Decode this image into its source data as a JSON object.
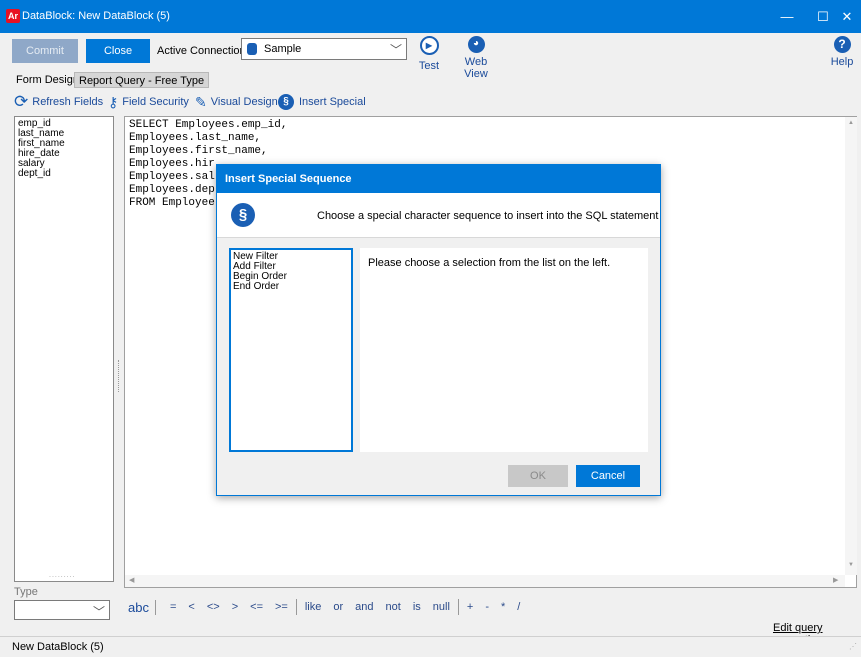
{
  "window": {
    "title": "DataBlock: New DataBlock (5)",
    "app_badge": "Ar",
    "minimize": "—",
    "maximize": "☐",
    "close": "✕"
  },
  "toolbar": {
    "commit": "Commit",
    "close": "Close",
    "active_connection_label": "Active Connection",
    "connection_value": "Sample",
    "test": "Test",
    "web_view": "Web View",
    "help": "Help"
  },
  "tabs": [
    "Form Design",
    "Report Query - Free Type"
  ],
  "subtoolbar": {
    "refresh_fields": "Refresh Fields",
    "field_security": "Field Security",
    "visual_design": "Visual Design",
    "insert_special": "Insert Special"
  },
  "fields": [
    "emp_id",
    "last_name",
    "first_name",
    "hire_date",
    "salary",
    "dept_id"
  ],
  "sql_lines": [
    "SELECT Employees.emp_id,",
    "Employees.last_name,",
    "Employees.first_name,",
    "Employees.hir",
    "Employees.sal",
    "Employees.dep",
    "FROM Employee"
  ],
  "type_label": "Type",
  "operators": [
    "=",
    "<",
    "<>",
    ">",
    "<=",
    ">=",
    "like",
    "or",
    "and",
    "not",
    "is",
    "null",
    "+",
    "-",
    "*",
    "/"
  ],
  "abc_glyph": "abc",
  "edit_query_properties": "Edit query properties",
  "status_text": "New DataBlock (5)",
  "dialog": {
    "title": "Insert Special Sequence",
    "message": "Choose a special character sequence to insert into the SQL statement",
    "items": [
      "New Filter",
      "Add Filter",
      "Begin Order",
      "End Order"
    ],
    "detail": "Please choose a selection from the list on the left.",
    "ok": "OK",
    "cancel": "Cancel"
  }
}
